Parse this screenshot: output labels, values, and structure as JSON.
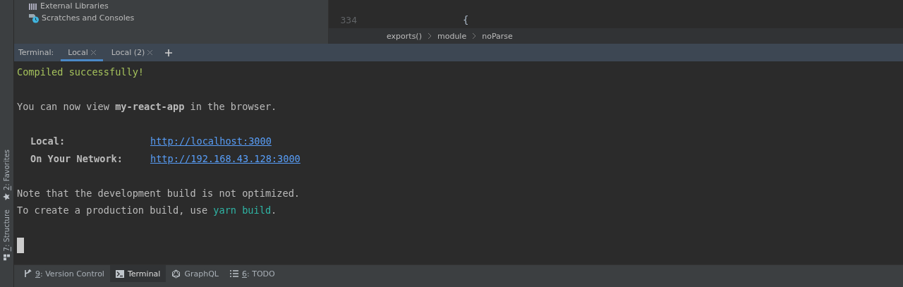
{
  "side_stripe": [
    {
      "mnemonic": "2",
      "label": ": Favorites",
      "kind": "star"
    },
    {
      "mnemonic": "7",
      "label": ": Structure",
      "kind": "structure"
    }
  ],
  "project_tree": {
    "items": [
      {
        "label": "External Libraries",
        "kind": "library"
      },
      {
        "label": "Scratches and Consoles",
        "kind": "scratch"
      }
    ]
  },
  "editor": {
    "lines": [
      {
        "number": "334",
        "code": "{"
      }
    ],
    "breadcrumbs": [
      "exports()",
      "module",
      "noParse"
    ]
  },
  "terminal": {
    "label": "Terminal:",
    "tabs": [
      {
        "label": "Local",
        "selected": true
      },
      {
        "label": "Local (2)",
        "selected": false
      }
    ],
    "lines": [
      {
        "kind": "success",
        "text": "Compiled successfully!"
      },
      {
        "kind": "blank"
      },
      {
        "kind": "text",
        "text": "You can now view **my-react-app** in the browser."
      },
      {
        "kind": "blank"
      },
      {
        "kind": "address",
        "label": "Local:",
        "url": "http://localhost:3000"
      },
      {
        "kind": "address",
        "label": "On Your Network:",
        "url": "http://192.168.43.128:3000"
      },
      {
        "kind": "blank"
      },
      {
        "kind": "text",
        "text": "Note that the development build is not optimized."
      },
      {
        "kind": "segments",
        "segments": [
          {
            "kind": "plain",
            "text": "To create a production build, use "
          },
          {
            "kind": "command",
            "text": "yarn build"
          },
          {
            "kind": "plain",
            "text": "."
          }
        ]
      },
      {
        "kind": "blank"
      },
      {
        "kind": "cursor"
      }
    ]
  },
  "tool_windows": [
    {
      "kind": "branch",
      "mnemonic": "9",
      "label": ": Version Control",
      "selected": false
    },
    {
      "kind": "terminal",
      "label": "Terminal",
      "selected": true
    },
    {
      "kind": "graphql",
      "label": "GraphQL",
      "selected": false
    },
    {
      "kind": "list",
      "mnemonic": "6",
      "label": ": TODO",
      "selected": false
    }
  ]
}
